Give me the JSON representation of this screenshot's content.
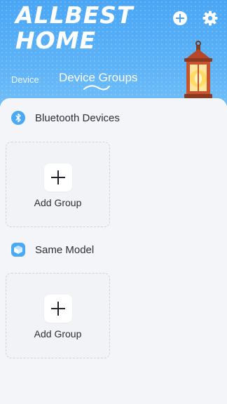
{
  "header": {
    "brand_line1": "ALLBEST",
    "brand_line2": "HOME",
    "icons": [
      "add-icon",
      "gear-icon"
    ],
    "colors": {
      "header_blue": "#4aa6f5",
      "accent": "#47a6f2"
    }
  },
  "tabs": [
    {
      "label": "Device",
      "active": false
    },
    {
      "label": "Device Groups",
      "active": true
    }
  ],
  "sections": [
    {
      "title": "Bluetooth Devices",
      "icon": "bluetooth-icon",
      "card": {
        "label": "Add Group",
        "icon": "plus-icon"
      }
    },
    {
      "title": "Same Model",
      "icon": "cube-icon",
      "card": {
        "label": "Add Group",
        "icon": "plus-icon"
      }
    }
  ]
}
